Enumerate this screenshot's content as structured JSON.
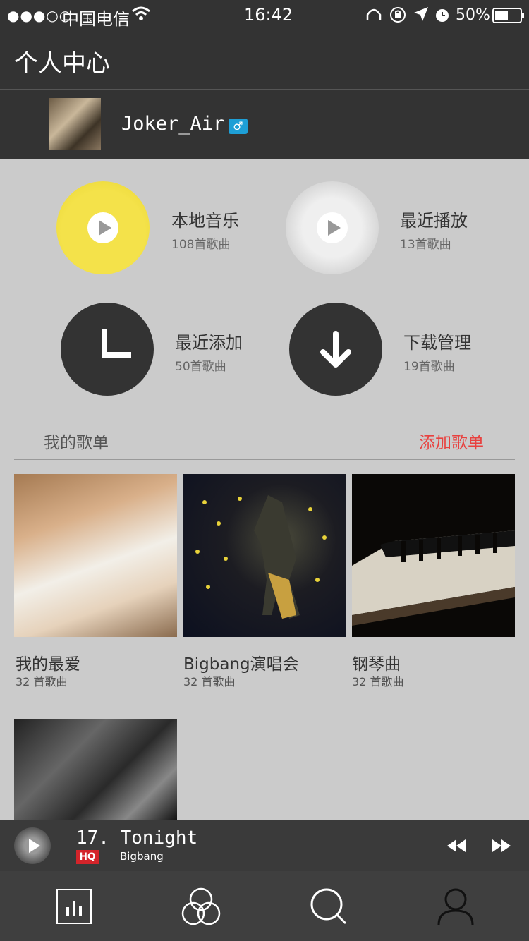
{
  "status": {
    "signal": "●●●○○",
    "carrier": "中国电信",
    "time": "16:42",
    "battery": "50%"
  },
  "header": {
    "title": "个人中心"
  },
  "profile": {
    "name": "Joker_Air",
    "gender_symbol": "♂"
  },
  "shortcuts": [
    {
      "title": "本地音乐",
      "count": "108首歌曲"
    },
    {
      "title": "最近播放",
      "count": "13首歌曲"
    },
    {
      "title": "最近添加",
      "count": "50首歌曲"
    },
    {
      "title": "下载管理",
      "count": "19首歌曲"
    }
  ],
  "playlists": {
    "label": "我的歌单",
    "add_label": "添加歌单",
    "items": [
      {
        "name": "我的最爱",
        "count": "32 首歌曲"
      },
      {
        "name": "Bigbang演唱会",
        "count": "32 首歌曲"
      },
      {
        "name": "钢琴曲",
        "count": "32 首歌曲"
      }
    ]
  },
  "player": {
    "song": "17. Tonight",
    "quality": "HQ",
    "artist": "Bigbang"
  },
  "tabs": [
    "chart-icon",
    "circles-icon",
    "search-icon",
    "profile-icon"
  ],
  "colors": {
    "accent": "#e8413f",
    "bar": "#333333",
    "background": "#cbcbcb",
    "gender": "#1e9fd6"
  }
}
